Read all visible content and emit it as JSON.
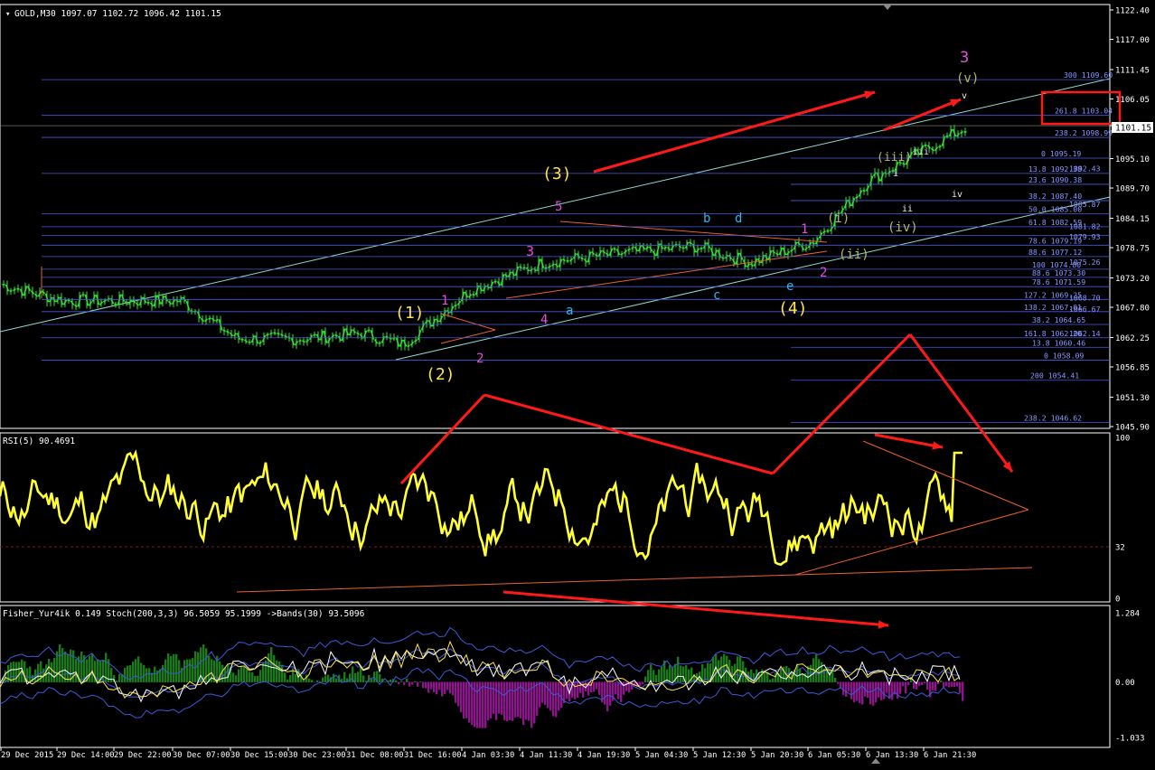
{
  "colors": {
    "background": "#000000",
    "panel_border": "#ffffff",
    "price_bars": "#2ee62e",
    "fib_lines": "#4a5adc",
    "fib_text": "#8a96ff",
    "channel": "#8fd9d0",
    "rsi_line": "#ffff33",
    "arrow": "#ff1a1a",
    "wave_yellow": "#ffe34d",
    "wave_magenta": "#e64ddc",
    "wave_cyan": "#33b4f0",
    "wave_olive": "#b5b86a",
    "wave_white": "#f0f0f0",
    "histogram_up": "#1a7a1a",
    "histogram_down": "#8a168a",
    "bands": "#3c5ad8",
    "fisher_line": "#ffffff",
    "stoch_line": "#ffe34d"
  },
  "price_panel": {
    "header": "GOLD,M30  1097.07 1102.72 1096.42 1101.15",
    "current_price": "1101.15",
    "axis_ticks": [
      "1122.40",
      "1117.00",
      "1111.45",
      "1106.05",
      "1101.15",
      "1095.10",
      "1089.70",
      "1084.15",
      "1078.75",
      "1073.20",
      "1067.80",
      "1062.25",
      "1056.85",
      "1051.30",
      "1045.90"
    ],
    "fib_labels": [
      "300 1109.60",
      "261.8 1103.04",
      "238.2 1098.99",
      "0 1095.19",
      "13.8 1092.38",
      "1092.43",
      "23.6 1090.38",
      "38.2 1087.40",
      "50.0 1085.00",
      "1085.87",
      "61.8 1082.59",
      "1081.82",
      "78.6 1079.19",
      "1079.93",
      "88.6 1077.12",
      "100 1074.80",
      "1075.26",
      "88.6 1073.30",
      "78.6 1071.59",
      "127.2 1069.25",
      "1068.70",
      "138.2 1067.01",
      "1066.67",
      "38.2 1064.65",
      "161.8 1062.20",
      "1062.14",
      "13.8 1060.46",
      "0 1058.09",
      "200 1054.41",
      "238.2 1046.62"
    ],
    "wave_labels": [
      {
        "text": "(1)",
        "color": "wave_yellow"
      },
      {
        "text": "(2)",
        "color": "wave_yellow"
      },
      {
        "text": "(3)",
        "color": "wave_yellow"
      },
      {
        "text": "(4)",
        "color": "wave_yellow"
      },
      {
        "text": "1",
        "color": "wave_magenta"
      },
      {
        "text": "2",
        "color": "wave_magenta"
      },
      {
        "text": "3",
        "color": "wave_magenta"
      },
      {
        "text": "4",
        "color": "wave_magenta"
      },
      {
        "text": "5",
        "color": "wave_magenta"
      },
      {
        "text": "1",
        "color": "wave_magenta"
      },
      {
        "text": "2",
        "color": "wave_magenta"
      },
      {
        "text": "3",
        "color": "wave_magenta"
      },
      {
        "text": "a",
        "color": "wave_cyan"
      },
      {
        "text": "b",
        "color": "wave_cyan"
      },
      {
        "text": "c",
        "color": "wave_cyan"
      },
      {
        "text": "d",
        "color": "wave_cyan"
      },
      {
        "text": "e",
        "color": "wave_cyan"
      },
      {
        "text": "(i)",
        "color": "wave_olive"
      },
      {
        "text": "(ii)",
        "color": "wave_olive"
      },
      {
        "text": "(iii)",
        "color": "wave_olive"
      },
      {
        "text": "(iv)",
        "color": "wave_olive"
      },
      {
        "text": "(v)",
        "color": "wave_olive"
      },
      {
        "text": "i",
        "color": "wave_white"
      },
      {
        "text": "ii",
        "color": "wave_white"
      },
      {
        "text": "iii",
        "color": "wave_white"
      },
      {
        "text": "iv",
        "color": "wave_white"
      },
      {
        "text": "v",
        "color": "wave_white"
      }
    ]
  },
  "rsi_panel": {
    "header": "RSI(5) 90.4691",
    "axis_ticks": [
      "100",
      "32",
      "0"
    ]
  },
  "fisher_panel": {
    "header": "Fisher_Yur4ik 0.149  Stoch(200,3,3) 96.5059 95.1999  ->Bands(30) 93.5096",
    "axis_ticks": [
      "1.284",
      "0.00",
      "-1.033"
    ]
  },
  "time_axis": [
    "29 Dec 2015",
    "29 Dec 14:00",
    "29 Dec 22:00",
    "30 Dec 07:00",
    "30 Dec 15:00",
    "30 Dec 23:00",
    "31 Dec 08:00",
    "31 Dec 16:00",
    "4 Jan 03:30",
    "4 Jan 11:30",
    "4 Jan 19:30",
    "5 Jan 04:30",
    "5 Jan 12:30",
    "5 Jan 20:30",
    "6 Jan 05:30",
    "6 Jan 13:30",
    "6 Jan 21:30"
  ],
  "chart_data": [
    {
      "type": "line",
      "title": "GOLD,M30",
      "ohlc_last": {
        "open": 1097.07,
        "high": 1102.72,
        "low": 1096.42,
        "close": 1101.15
      },
      "x": [
        "29 Dec 2015",
        "29 Dec 14:00",
        "29 Dec 22:00",
        "30 Dec 07:00",
        "30 Dec 15:00",
        "30 Dec 23:00",
        "31 Dec 08:00",
        "31 Dec 16:00",
        "4 Jan 03:30",
        "4 Jan 11:30",
        "4 Jan 19:30",
        "5 Jan 04:30",
        "5 Jan 12:30",
        "5 Jan 20:30",
        "6 Jan 05:30",
        "6 Jan 13:30",
        "6 Jan 21:30"
      ],
      "series": [
        {
          "values": [
            1072,
            1069,
            1069,
            1069,
            1062,
            1062,
            1063,
            1061,
            1071,
            1076,
            1077,
            1078,
            1079,
            1076,
            1080,
            1091,
            1101
          ]
        }
      ],
      "ylim": [
        1045.9,
        1122.4
      ]
    },
    {
      "type": "line",
      "title": "RSI(5)",
      "last": 90.4691,
      "level": 32,
      "ylim": [
        0,
        100
      ]
    },
    {
      "type": "bar",
      "title": "Fisher_Yur4ik",
      "last_values": {
        "fisher": 0.149,
        "stoch_main": 96.5059,
        "stoch_signal": 95.1999,
        "bands": 93.5096
      },
      "ylim": [
        -1.033,
        1.284
      ]
    }
  ]
}
